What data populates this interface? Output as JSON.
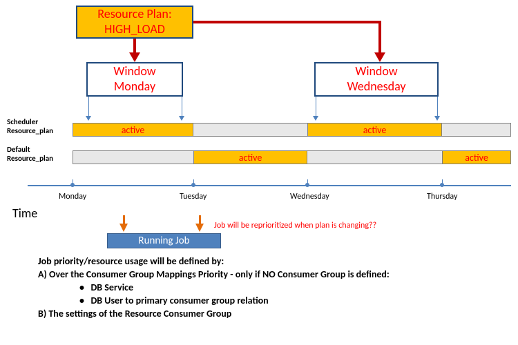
{
  "resourcePlan": {
    "line1": "Resource Plan:",
    "line2": "HIGH_LOAD"
  },
  "windows": {
    "monday": {
      "line1": "Window",
      "line2": "Monday"
    },
    "wednesday": {
      "line1": "Window",
      "line2": "Wednesday"
    }
  },
  "rowLabels": {
    "scheduler": {
      "l1": "Scheduler",
      "l2": "Resource_plan"
    },
    "default": {
      "l1": "Default",
      "l2": "Resource_plan"
    }
  },
  "active": "active",
  "timeline": {
    "label": "Time",
    "ticks": [
      "Monday",
      "Tuesday",
      "Wednesday",
      "Thursday"
    ]
  },
  "job": {
    "label": "Running Job",
    "note": "Job will be reprioritized when plan is changing??"
  },
  "body": {
    "intro": "Job priority/resource  usage will be defined by:",
    "a": "A) Over the Consumer Group Mappings Priority - only if NO Consumer Group is defined:",
    "a1": "DB Service",
    "a2": "DB User to primary consumer group relation",
    "b": "B) The settings of the Resource Consumer Group"
  }
}
